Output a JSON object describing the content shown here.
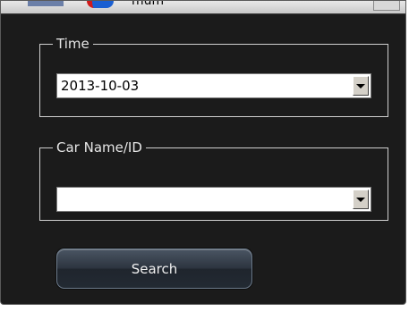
{
  "title_fragment": "mum",
  "time_group": {
    "legend": "Time",
    "value": "2013-10-03"
  },
  "car_group": {
    "legend": "Car Name/ID",
    "value": ""
  },
  "search_button": {
    "label": "Search"
  },
  "icons": [
    "dropdown-arrow-icon",
    "app-logo-icon"
  ]
}
